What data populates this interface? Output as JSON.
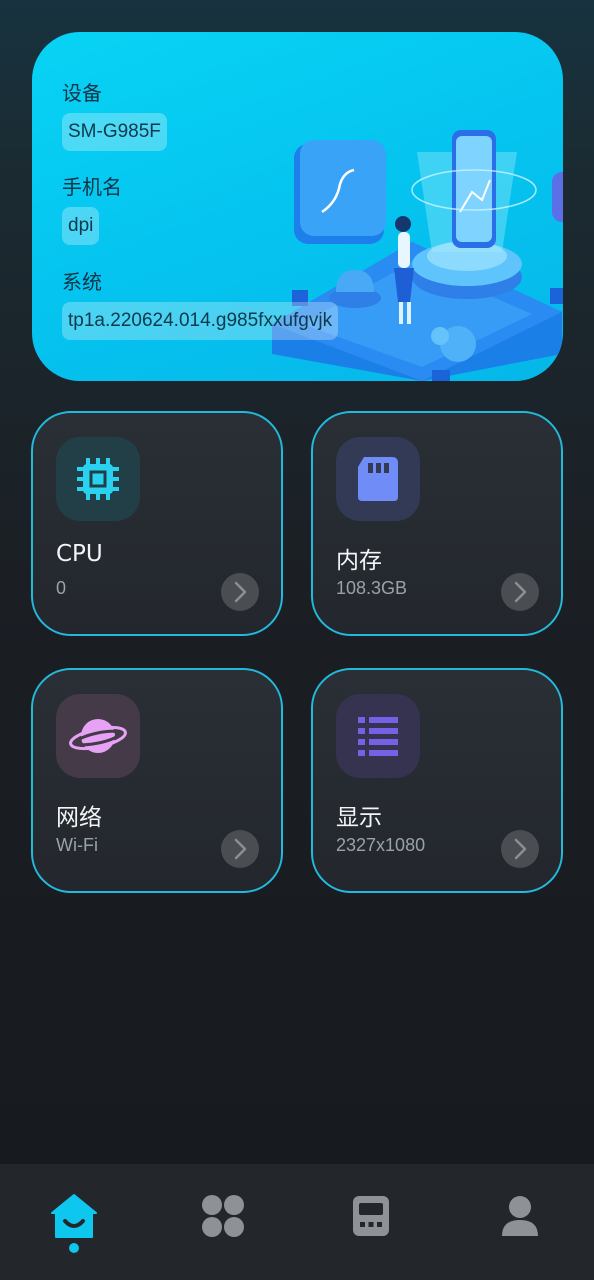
{
  "device_info": {
    "device_label": "设备",
    "device_value": "SM-G985F",
    "phone_name_label": "手机名",
    "phone_name_value": "dpi",
    "system_label": "系统",
    "system_value": "tp1a.220624.014.g985fxxufgvjk"
  },
  "tiles": [
    {
      "title": "CPU",
      "value": "0",
      "icon": "chip-icon",
      "accent": "#2bd2f0"
    },
    {
      "title": "内存",
      "value": "108.3GB",
      "icon": "sd-card-icon",
      "accent": "#6f8cf7"
    },
    {
      "title": "网络",
      "value": "Wi-Fi",
      "icon": "planet-icon",
      "accent": "#e7a2f5"
    },
    {
      "title": "显示",
      "value": "2327x1080",
      "icon": "list-icon",
      "accent": "#7561e6"
    }
  ],
  "bottom_nav": {
    "items": [
      "home-icon",
      "apps-icon",
      "device-icon",
      "user-icon"
    ],
    "active": "home-icon"
  },
  "colors": {
    "accent": "#0ec7ef",
    "tile_border": "#22b9dc",
    "hero_background": "#06c7f1"
  }
}
